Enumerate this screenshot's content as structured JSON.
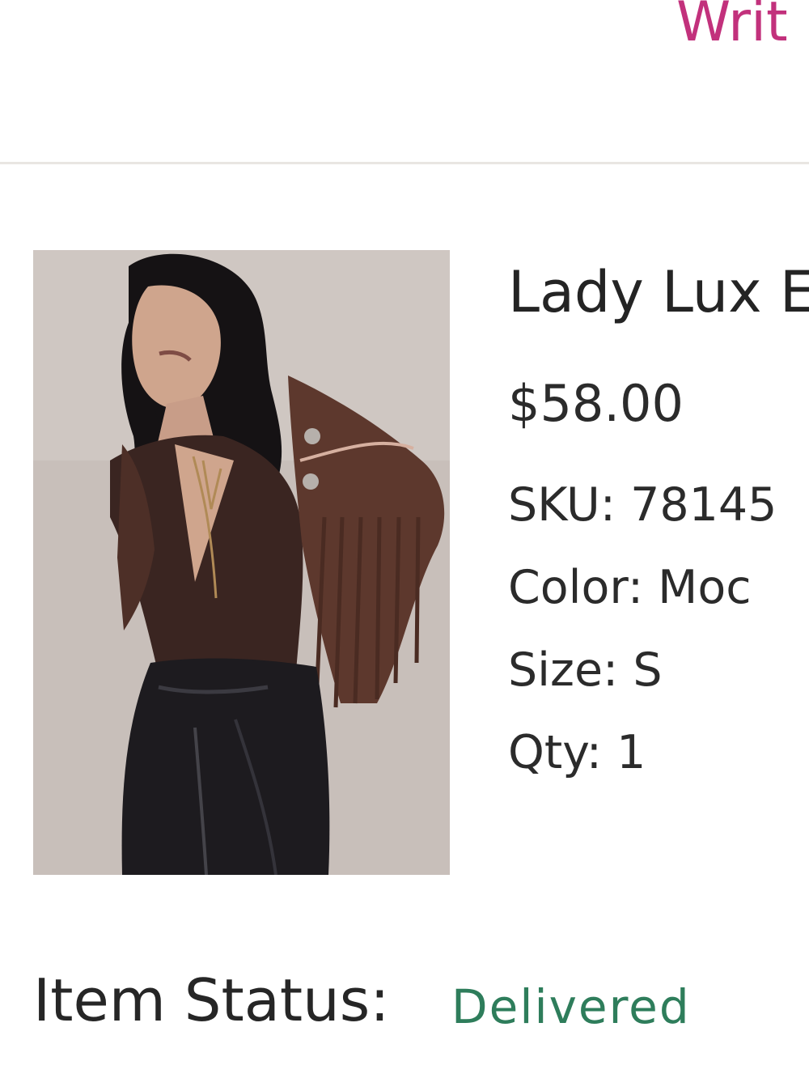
{
  "header": {
    "write_review_label": "Writ"
  },
  "product": {
    "name": "Lady Lux E",
    "price": "$58.00",
    "sku": "SKU: 78145",
    "color": "Color: Moc",
    "size": "Size: S",
    "qty": "Qty: 1"
  },
  "status": {
    "label": "Item Status:",
    "value": "Delivered"
  },
  "colors": {
    "link": "#c2317c",
    "delivered": "#2e7d5b",
    "divider": "#e9e6e2"
  }
}
